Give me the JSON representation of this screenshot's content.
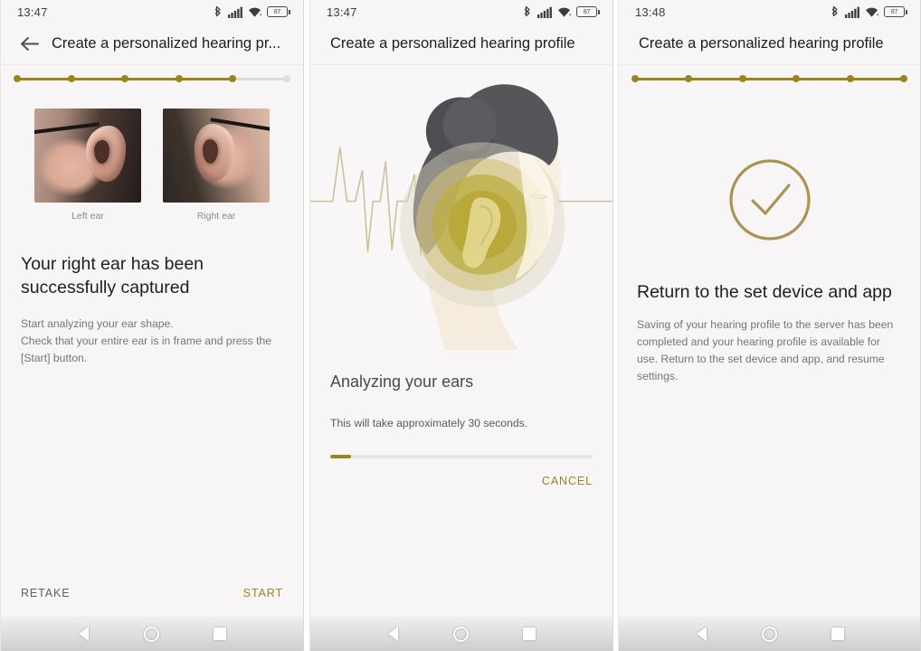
{
  "accent_gold": "#9b8420",
  "background": "#f7f5f5",
  "screens": [
    {
      "id": "capture-confirm",
      "status": {
        "time": "13:47",
        "icons": [
          "bluetooth-icon",
          "cellular-signal-icon",
          "wifi-icon",
          "battery-icon"
        ],
        "battery_level": "87"
      },
      "appbar": {
        "back_label": "back-arrow",
        "title": "Create a personalized hearing pr..."
      },
      "stepper": {
        "total": 6,
        "completed": 5
      },
      "ears": [
        {
          "label": "Left ear",
          "name": "left-ear-thumbnail"
        },
        {
          "label": "Right ear",
          "name": "right-ear-thumbnail"
        }
      ],
      "headline": "Your right ear has been successfully captured",
      "body": "Start analyzing your ear shape.\nCheck that your entire ear is in frame and press the [Start] button.",
      "actions": {
        "secondary": "RETAKE",
        "primary": "START"
      },
      "navbar": [
        "back-nav-icon",
        "home-nav-icon",
        "recents-nav-icon"
      ]
    },
    {
      "id": "analyzing",
      "status": {
        "time": "13:47",
        "icons": [
          "bluetooth-icon",
          "cellular-signal-icon",
          "wifi-icon",
          "battery-icon"
        ],
        "battery_level": "87"
      },
      "appbar": {
        "title": "Create a personalized hearing profile"
      },
      "illustration": "head-profile-soundwave-illustration",
      "headline": "Analyzing your ears",
      "body": "This will take approximately 30 seconds.",
      "progress_percent": 8,
      "actions": {
        "primary": "CANCEL"
      },
      "navbar": [
        "back-nav-icon",
        "home-nav-icon",
        "recents-nav-icon"
      ]
    },
    {
      "id": "complete",
      "status": {
        "time": "13:48",
        "icons": [
          "bluetooth-icon",
          "cellular-signal-icon",
          "wifi-icon",
          "battery-icon"
        ],
        "battery_level": "87"
      },
      "appbar": {
        "title": "Create a personalized hearing profile"
      },
      "stepper": {
        "total": 6,
        "completed": 6
      },
      "success_icon": "check-circle-icon",
      "headline": "Return to the set device and app",
      "body": "Saving of your hearing profile to the server has been completed and your hearing profile is available for use. Return to the set device and app, and resume settings.",
      "navbar": [
        "back-nav-icon",
        "home-nav-icon",
        "recents-nav-icon"
      ]
    }
  ]
}
